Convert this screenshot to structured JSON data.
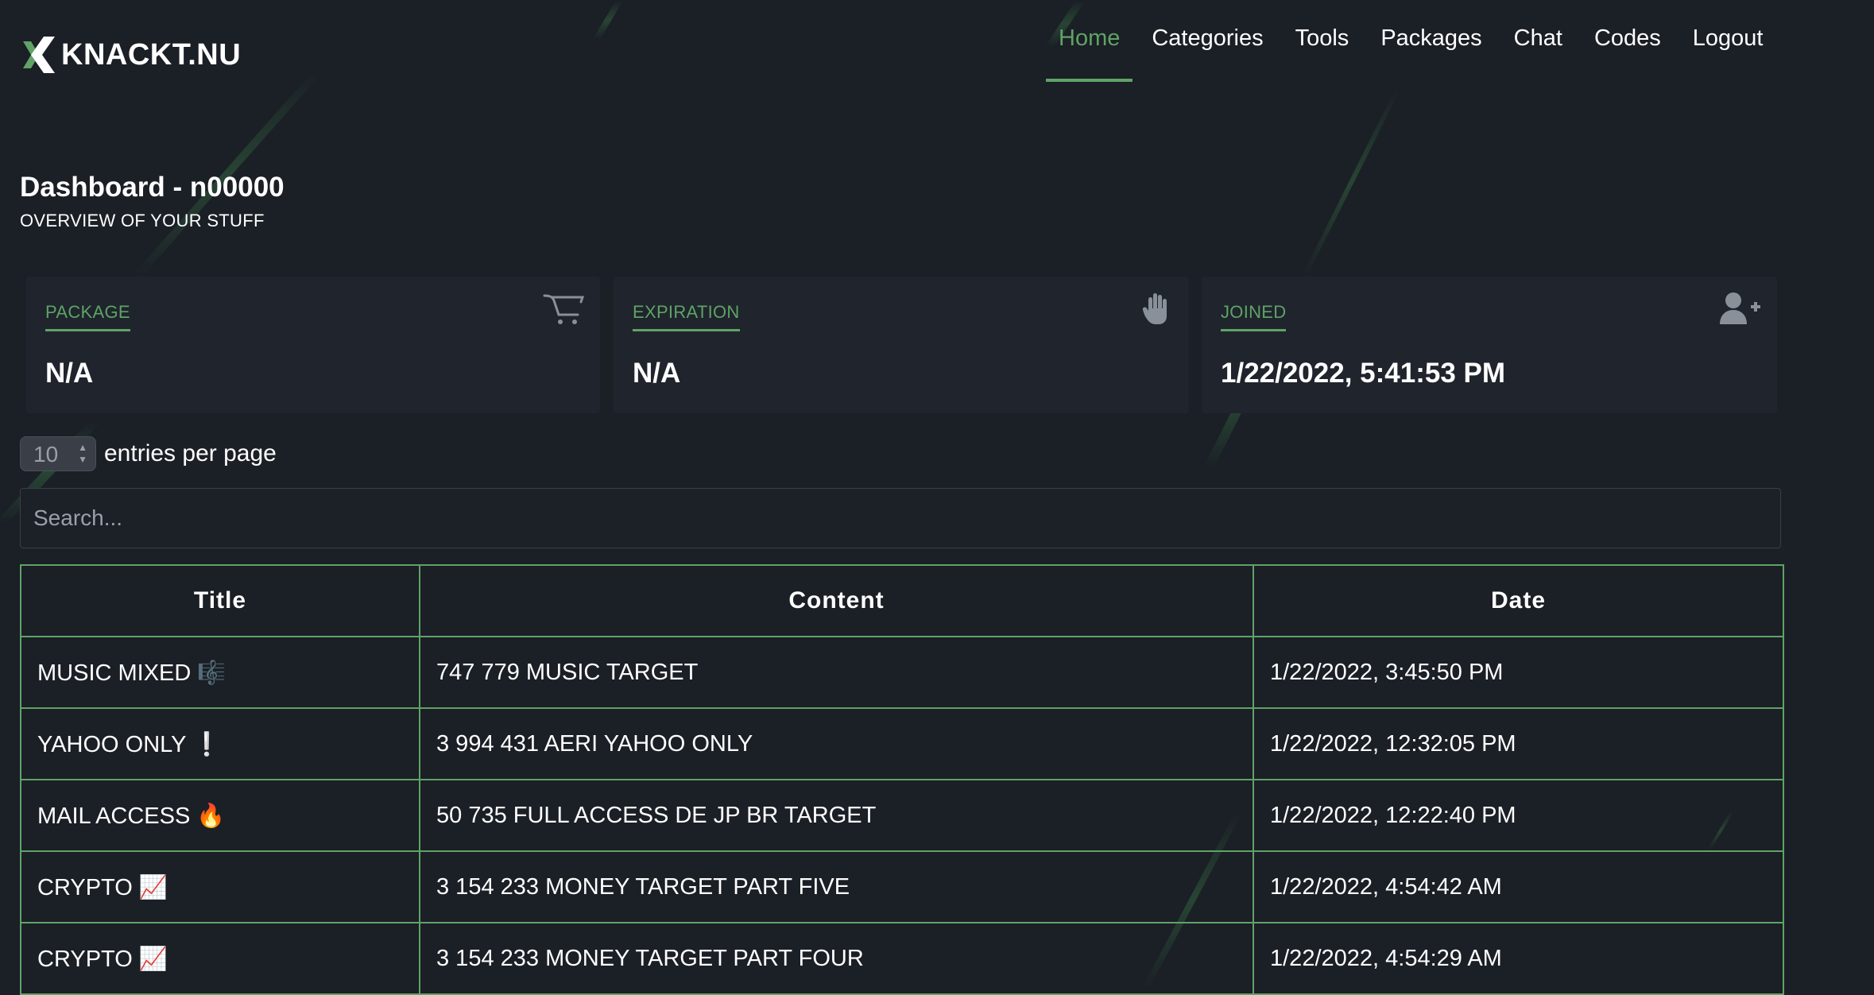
{
  "header": {
    "logo_text": "KNACKT.NU",
    "nav": [
      {
        "label": "Home",
        "active": true
      },
      {
        "label": "Categories",
        "active": false
      },
      {
        "label": "Tools",
        "active": false
      },
      {
        "label": "Packages",
        "active": false
      },
      {
        "label": "Chat",
        "active": false
      },
      {
        "label": "Codes",
        "active": false
      },
      {
        "label": "Logout",
        "active": false
      }
    ]
  },
  "dashboard": {
    "title": "Dashboard - n00000",
    "subtitle": "OVERVIEW OF YOUR STUFF"
  },
  "cards": [
    {
      "label": "PACKAGE",
      "value": "N/A",
      "icon": "cart-icon"
    },
    {
      "label": "EXPIRATION",
      "value": "N/A",
      "icon": "hand-icon"
    },
    {
      "label": "JOINED",
      "value": "1/22/2022, 5:41:53 PM",
      "icon": "user-plus-icon"
    }
  ],
  "entries": {
    "value": "10",
    "label": "entries per page"
  },
  "search": {
    "placeholder": "Search..."
  },
  "table": {
    "headers": [
      "Title",
      "Content",
      "Date"
    ],
    "rows": [
      {
        "title": "MUSIC MIXED",
        "emoji": "🎼",
        "content": "747 779 MUSIC TARGET",
        "date": "1/22/2022, 3:45:50 PM"
      },
      {
        "title": "YAHOO ONLY",
        "emoji": "❕",
        "content": "3 994 431 AERI YAHOO ONLY",
        "date": "1/22/2022, 12:32:05 PM"
      },
      {
        "title": "MAIL ACCESS",
        "emoji": "🔥",
        "content": "50 735 FULL ACCESS DE JP BR TARGET",
        "date": "1/22/2022, 12:22:40 PM"
      },
      {
        "title": "CRYPTO",
        "emoji": "📈",
        "content": "3 154 233 MONEY TARGET PART FIVE",
        "date": "1/22/2022, 4:54:42 AM"
      },
      {
        "title": "CRYPTO",
        "emoji": "📈",
        "content": "3 154 233 MONEY TARGET PART FOUR",
        "date": "1/22/2022, 4:54:29 AM"
      }
    ]
  },
  "colors": {
    "background": "#1b1f26",
    "card": "#1f242d",
    "accent": "#5fa365",
    "text": "#ffffff"
  }
}
